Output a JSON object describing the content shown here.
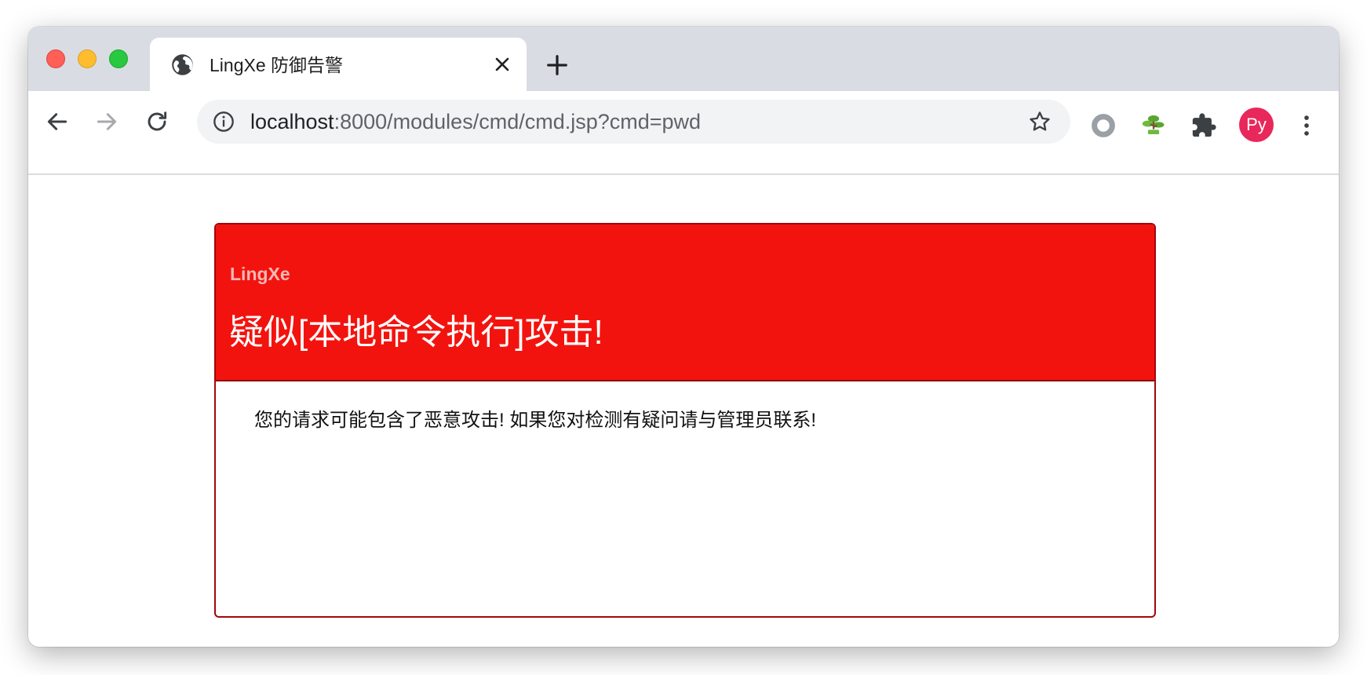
{
  "browser": {
    "tab": {
      "icon": "globe-icon",
      "title": "LingXe 防御告警"
    },
    "new_tab_icon": "plus-icon",
    "toolbar": {
      "back_icon": "back-arrow-icon",
      "forward_icon": "forward-arrow-icon",
      "reload_icon": "reload-icon",
      "url_host": "localhost",
      "url_rest": ":8000/modules/cmd/cmd.jsp?cmd=pwd",
      "site_info_icon": "info-icon",
      "bookmark_icon": "star-icon",
      "extensions": [
        "ring-extension-icon",
        "bonsai-extension-icon",
        "puzzle-icon"
      ],
      "profile_initials": "Py",
      "profile_color": "#e8275a",
      "menu_icon": "kebab-menu-icon"
    }
  },
  "alert": {
    "brand": "LingXe",
    "title": "疑似[本地命令执行]攻击!",
    "message": "您的请求可能包含了恶意攻击! 如果您对检测有疑问请与管理员联系!",
    "header_color": "#f3130e",
    "border_color": "#a1070c"
  }
}
